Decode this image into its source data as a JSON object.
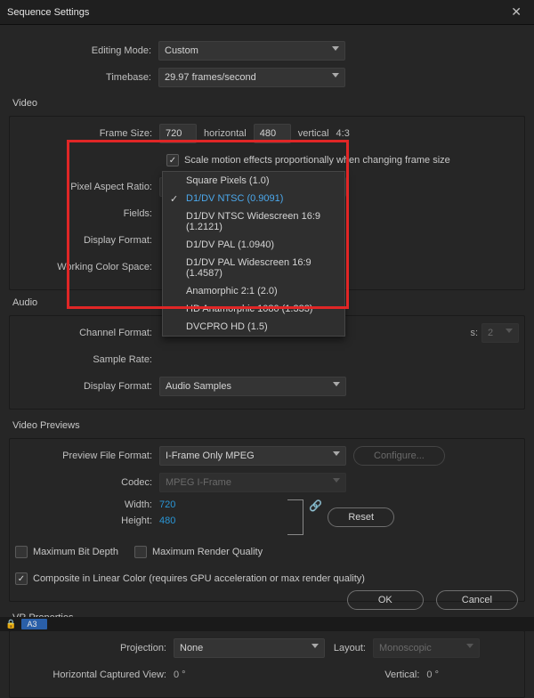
{
  "title": "Sequence Settings",
  "labels": {
    "editing_mode": "Editing Mode:",
    "timebase": "Timebase:",
    "video_hdr": "Video",
    "frame_size": "Frame Size:",
    "horizontal": "horizontal",
    "vertical": "vertical",
    "aspect": "4:3",
    "scale_motion": "Scale motion effects proportionally when changing frame size",
    "pixel_aspect": "Pixel Aspect Ratio:",
    "fields": "Fields:",
    "display_format_v": "Display Format:",
    "working_cs": "Working Color Space:",
    "audio_hdr": "Audio",
    "channel_format": "Channel Format:",
    "num_channels": "Number of Channels:",
    "num_channels_abbrev": "s:",
    "sample_rate": "Sample Rate:",
    "display_format_a": "Display Format:",
    "previews_hdr": "Video Previews",
    "preview_file_format": "Preview File Format:",
    "configure": "Configure...",
    "codec": "Codec:",
    "width": "Width:",
    "height": "Height:",
    "reset": "Reset",
    "max_bit_depth": "Maximum Bit Depth",
    "max_render": "Maximum Render Quality",
    "composite_linear": "Composite in Linear Color (requires GPU acceleration or max render quality)",
    "vr_hdr": "VR Properties",
    "projection": "Projection:",
    "layout": "Layout:",
    "hcv": "Horizontal Captured View:",
    "vert": "Vertical:",
    "ok": "OK",
    "cancel": "Cancel"
  },
  "values": {
    "editing_mode": "Custom",
    "timebase": "29.97 frames/second",
    "frame_w": "720",
    "frame_h": "480",
    "pixel_aspect": "D1/DV NTSC (0.9091)",
    "num_channels": "2",
    "display_format_a": "Audio Samples",
    "preview_file_format": "I-Frame Only MPEG",
    "codec": "MPEG I-Frame",
    "preview_w": "720",
    "preview_h": "480",
    "projection": "None",
    "layout": "Monoscopic",
    "hcv": "0 °",
    "vert": "0 °"
  },
  "pixel_aspect_options": [
    {
      "label": "Square Pixels (1.0)",
      "selected": false
    },
    {
      "label": "D1/DV NTSC (0.9091)",
      "selected": true
    },
    {
      "label": "D1/DV NTSC Widescreen 16:9 (1.2121)",
      "selected": false
    },
    {
      "label": "D1/DV PAL (1.0940)",
      "selected": false
    },
    {
      "label": "D1/DV PAL Widescreen 16:9 (1.4587)",
      "selected": false
    },
    {
      "label": "Anamorphic 2:1 (2.0)",
      "selected": false
    },
    {
      "label": "HD Anamorphic 1080 (1.333)",
      "selected": false
    },
    {
      "label": "DVCPRO HD (1.5)",
      "selected": false
    }
  ],
  "checks": {
    "scale_motion": true,
    "max_bit_depth": false,
    "max_render": false,
    "composite_linear": true
  },
  "timeline_track": "A3"
}
